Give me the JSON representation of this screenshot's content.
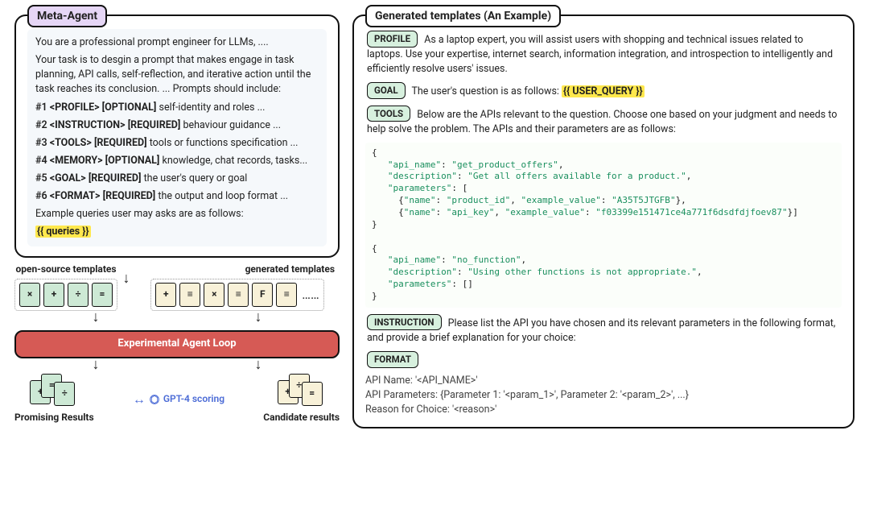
{
  "left": {
    "meta_agent": {
      "title": "Meta-Agent",
      "intro1": "You are a professional prompt engineer for LLMs, ....",
      "intro2": "Your task is to desgin a prompt that makes engage in task planning, API calls, self-reflection, and iterative action until the task reaches its conclusion.  ... Prompts should include:",
      "items": [
        {
          "num": "#1",
          "tag": "<PROFILE>",
          "req": "[OPTIONAL]",
          "desc": "self-identity and roles ..."
        },
        {
          "num": "#2",
          "tag": "<INSTRUCTION>",
          "req": "[REQUIRED]",
          "desc": "behaviour guidance ..."
        },
        {
          "num": "#3",
          "tag": "<TOOLS>",
          "req": "[REQUIRED]",
          "desc": "tools or functions specification ..."
        },
        {
          "num": "#4",
          "tag": "<MEMORY>",
          "req": "[OPTIONAL]",
          "desc": "knowledge, chat records, tasks..."
        },
        {
          "num": "#5",
          "tag": "<GOAL>",
          "req": "[REQUIRED]",
          "desc": "the user's query or goal"
        },
        {
          "num": "#6",
          "tag": "<FORMAT>",
          "req": "[REQUIRED]",
          "desc": "the output and loop format ..."
        }
      ],
      "example_line": "Example queries user may asks are as follows:",
      "queries_placeholder": "{{ queries }}"
    },
    "open_source_label": "open-source templates",
    "generated_label": "generated templates",
    "open_icons": [
      "×",
      "+",
      "÷",
      "="
    ],
    "gen_icons": [
      "+",
      "≡",
      "×",
      "≡",
      "F",
      "≡"
    ],
    "gen_ellipsis": "……",
    "loop_label": "Experimental Agent Loop",
    "promising_label": "Promising Results",
    "candidate_label": "Candidate results",
    "scoring_label": "GPT-4 scoring"
  },
  "right": {
    "title": "Generated templates (An Example)",
    "profile_badge": "PROFILE",
    "profile_text": "As a laptop expert, you will assist users with shopping and technical issues related to laptops. Use your expertise, internet search, information integration, and introspection to intelligently and efficiently resolve users' issues.",
    "goal_badge": "GOAL",
    "goal_text_before": "The user's question is as follows: ",
    "goal_placeholder": "{{ USER_QUERY }}",
    "tools_badge": "TOOLS",
    "tools_text": "Below are the APIs relevant to the question. Choose one based on your judgment and needs to help solve the problem. The APIs and their parameters are as follows:",
    "api1": {
      "name": "get_product_offers",
      "desc": "Get all offers available for a product.",
      "p1_name": "product_id",
      "p1_ex": "A35T5JTGFB",
      "p2_name": "api_key",
      "p2_ex": "f03399e151471ce4a771f6dsdfdjfoev87"
    },
    "api2": {
      "name": "no_function",
      "desc": "Using other functions is not appropriate."
    },
    "instruction_badge": "INSTRUCTION",
    "instruction_text": "Please list the API you have chosen and its relevant parameters in the following format, and provide a brief explanation for your choice:",
    "format_badge": "FORMAT",
    "format_lines": {
      "l1": "API Name: '<API_NAME>'",
      "l2": "API Parameters: {Parameter 1: '<param_1>', Parameter 2: '<param_2>', ...}",
      "l3": "Reason for Choice: '<reason>'"
    }
  }
}
